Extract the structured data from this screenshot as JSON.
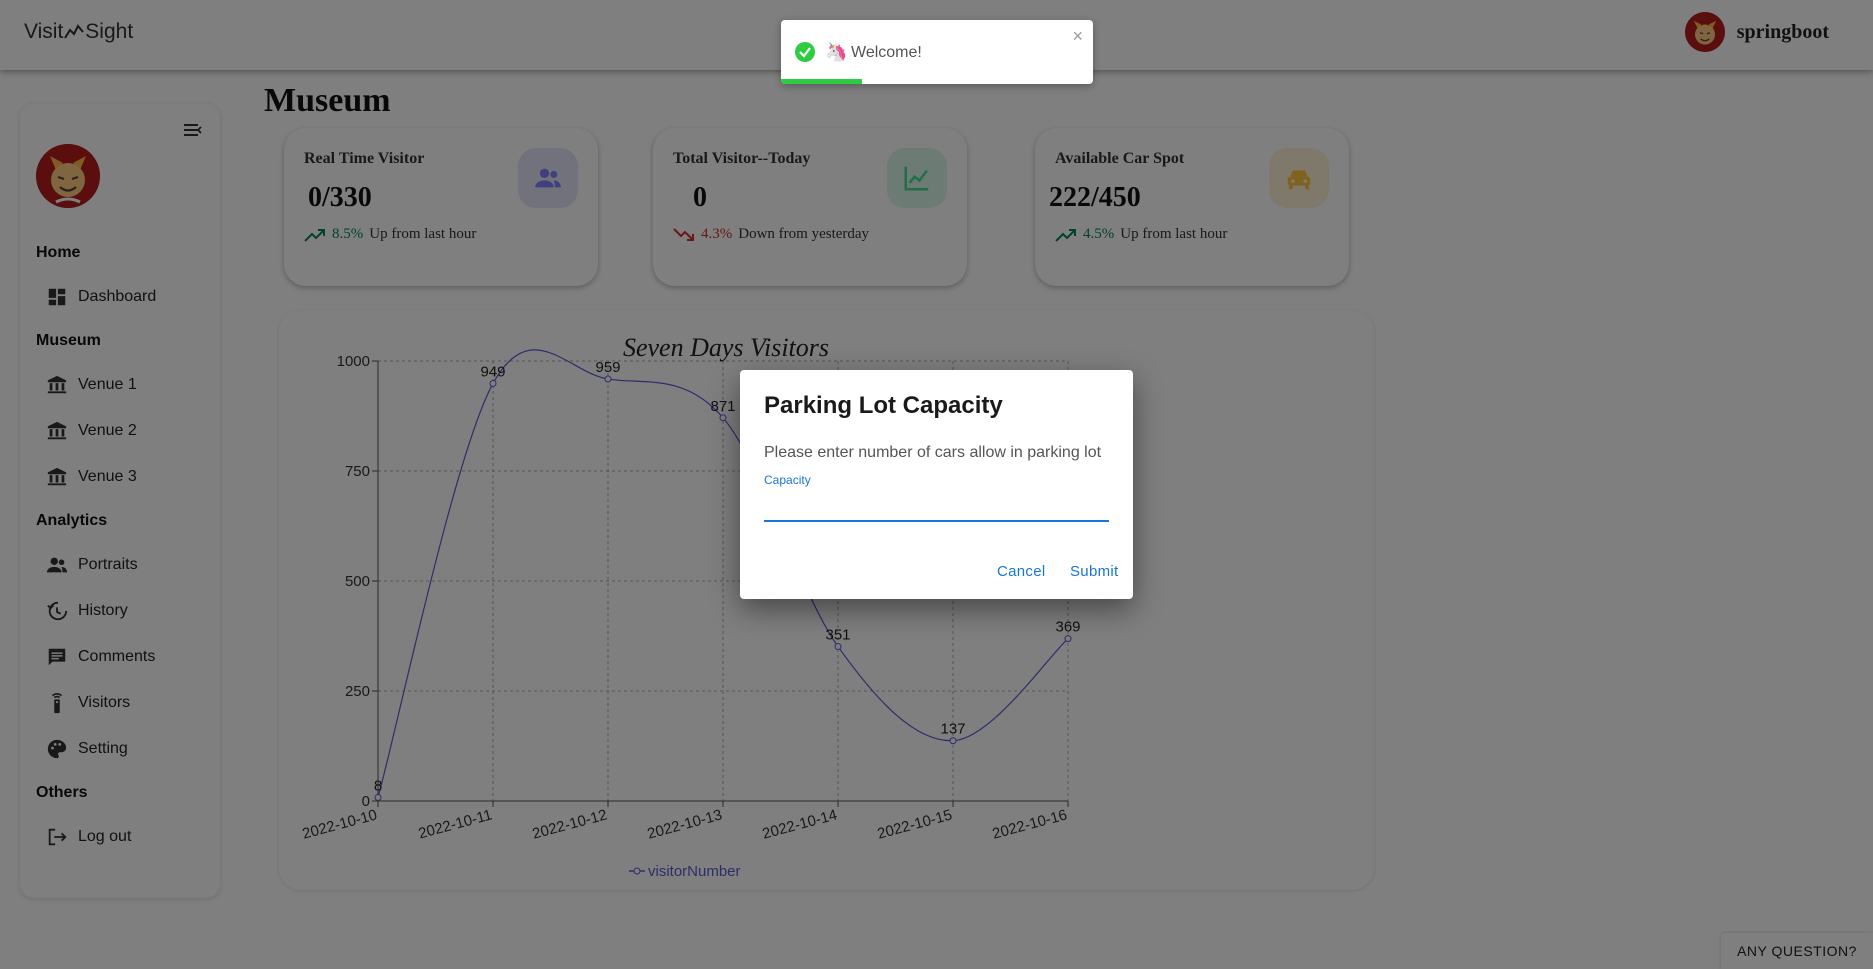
{
  "app": {
    "logo_left": "Visit",
    "logo_right": "Sight"
  },
  "user": {
    "name": "springboot"
  },
  "sidebar": {
    "sections": [
      {
        "heading": "Home",
        "items": [
          {
            "label": "Dashboard",
            "icon": "dashboard-icon"
          }
        ]
      },
      {
        "heading": "Museum",
        "items": [
          {
            "label": "Venue 1",
            "icon": "museum-icon"
          },
          {
            "label": "Venue 2",
            "icon": "museum-icon"
          },
          {
            "label": "Venue 3",
            "icon": "museum-icon"
          }
        ]
      },
      {
        "heading": "Analytics",
        "items": [
          {
            "label": "Portraits",
            "icon": "people-icon"
          },
          {
            "label": "History",
            "icon": "history-icon"
          },
          {
            "label": "Comments",
            "icon": "comment-icon"
          },
          {
            "label": "Visitors",
            "icon": "remote-icon"
          },
          {
            "label": "Setting",
            "icon": "palette-icon"
          }
        ]
      },
      {
        "heading": "Others",
        "items": [
          {
            "label": "Log out",
            "icon": "logout-icon"
          }
        ]
      }
    ]
  },
  "main": {
    "title": "Museum",
    "cards": [
      {
        "label": "Real Time Visitor",
        "value": "0/330",
        "trend_pct": "8.5%",
        "trend_text": "Up from last hour",
        "direction": "up",
        "icon": "people-icon",
        "icon_bg": "#e5e4fb",
        "icon_color": "#8280ff"
      },
      {
        "label": "Total Visitor--Today",
        "value": "0",
        "trend_pct": "4.3%",
        "trend_text": "Down from yesterday",
        "direction": "down",
        "icon": "trend-icon",
        "icon_bg": "#d9f7e8",
        "icon_color": "#4ad991"
      },
      {
        "label": "Available Car Spot",
        "value": "222/450",
        "trend_pct": "4.5%",
        "trend_text": "Up from last hour",
        "direction": "up",
        "icon": "car-icon",
        "icon_bg": "#fff3d6",
        "icon_color": "#fec53d"
      }
    ]
  },
  "chart_data": {
    "type": "line",
    "title": "Seven Days Visitors",
    "categories": [
      "2022-10-10",
      "2022-10-11",
      "2022-10-12",
      "2022-10-13",
      "2022-10-14",
      "2022-10-15",
      "2022-10-16"
    ],
    "series": [
      {
        "name": "visitorNumber",
        "values": [
          8,
          949,
          959,
          871,
          351,
          137,
          369
        ]
      }
    ],
    "ylim": [
      0,
      1000
    ],
    "yticks": [
      0,
      250,
      500,
      750,
      1000
    ],
    "grid": true,
    "legend": "bottom",
    "line_color": "#5b5bd6"
  },
  "dialog": {
    "title": "Parking Lot Capacity",
    "text": "Please enter number of cars allow in parking lot",
    "field_label": "Capacity",
    "field_value": "",
    "cancel_label": "Cancel",
    "submit_label": "Submit"
  },
  "toast": {
    "emoji": "🦄",
    "message": "Welcome!",
    "progress": 0.26
  },
  "help": {
    "label": "ANY QUESTION?"
  },
  "colors": {
    "accent": "#1976d2",
    "success": "#2ecc40",
    "up": "#00875a",
    "down": "#d32f2f"
  }
}
